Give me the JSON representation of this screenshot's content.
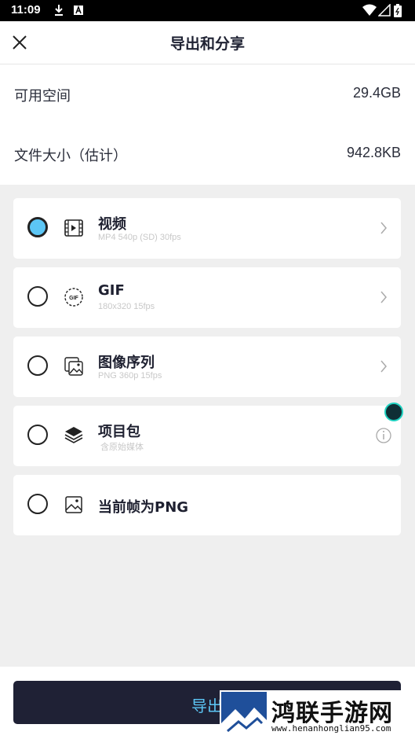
{
  "status_bar": {
    "time": "11:09",
    "icons": [
      "download-icon",
      "a-box-icon",
      "wifi-icon",
      "signal-icon",
      "battery-icon"
    ]
  },
  "header": {
    "title": "导出和分享"
  },
  "storage": {
    "available_label": "可用空间",
    "available_value": "29.4GB",
    "size_label": "文件大小（估计）",
    "size_value": "942.8KB"
  },
  "options": [
    {
      "name": "视频",
      "detail": "MP4 540p (SD) 30fps",
      "icon": "video-icon",
      "selected": true
    },
    {
      "name": "GIF",
      "detail": "180x320 15fps",
      "icon": "gif-icon",
      "selected": false
    },
    {
      "name": "图像序列",
      "detail": "PNG 360p 15fps",
      "icon": "image-sequence-icon",
      "selected": false
    },
    {
      "name": "项目包",
      "detail": "含原始媒体",
      "icon": "layers-icon",
      "selected": false
    },
    {
      "name": "当前帧为PNG",
      "icon": "image-icon",
      "selected": false
    }
  ],
  "export_button": {
    "label": "导出"
  },
  "watermark": {
    "name": "鸿联手游网",
    "url": "www.henanhonglian95.com"
  },
  "colors": {
    "accent": "#5cc6f5",
    "button_bg": "#1f2135",
    "background": "#efefef"
  }
}
